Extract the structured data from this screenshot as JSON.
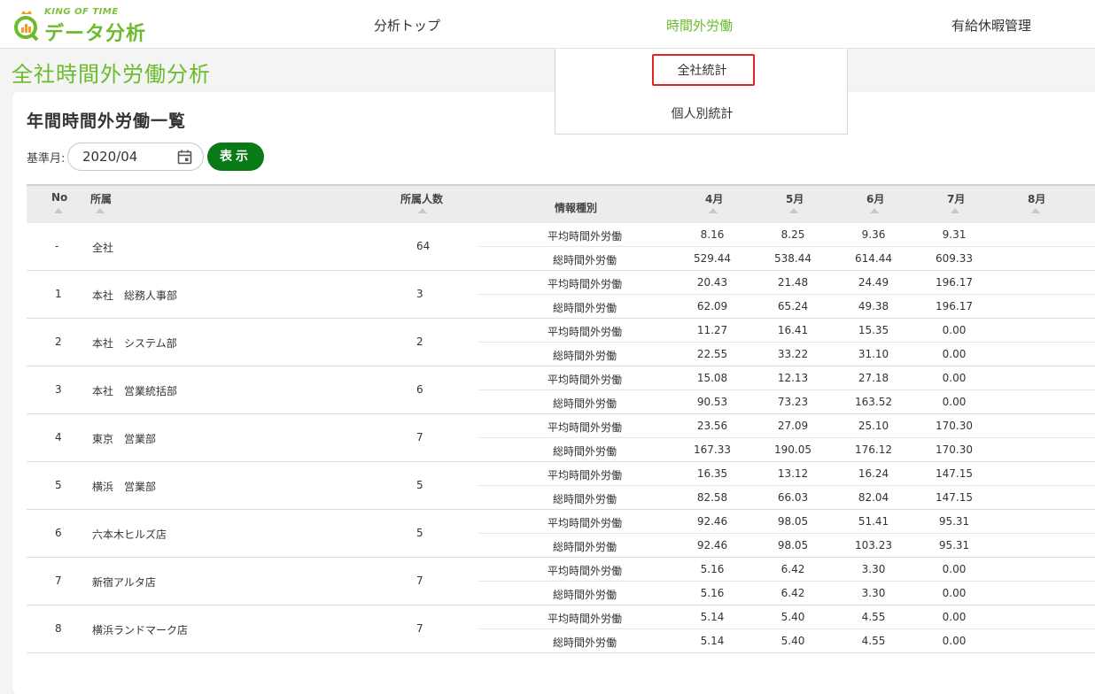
{
  "header": {
    "logo_brand": "KING OF TIME",
    "logo_title": "データ分析",
    "nav": [
      "分析トップ",
      "時間外労働",
      "有給休暇管理"
    ]
  },
  "dropdown": {
    "items": [
      "全社統計",
      "個人別統計"
    ]
  },
  "page_title": "全社時間外労働分析",
  "card": {
    "title": "年間時間外労働一覧",
    "filter_label": "基準月:",
    "month_value": "2020/04",
    "show_button": "表示"
  },
  "table": {
    "headers": {
      "no": "No",
      "dept": "所属",
      "count": "所属人数",
      "info": "情報種別",
      "months": [
        "4月",
        "5月",
        "6月",
        "7月",
        "8月"
      ]
    },
    "metric_labels": [
      "平均時間外労働",
      "総時間外労働"
    ],
    "rows": [
      {
        "no": "-",
        "dept": "全社",
        "count": "64",
        "avg": [
          "8.16",
          "8.25",
          "9.36",
          "9.31"
        ],
        "total": [
          "529.44",
          "538.44",
          "614.44",
          "609.33"
        ]
      },
      {
        "no": "1",
        "dept": "本社　総務人事部",
        "count": "3",
        "avg": [
          "20.43",
          "21.48",
          "24.49",
          "196.17"
        ],
        "total": [
          "62.09",
          "65.24",
          "49.38",
          "196.17"
        ]
      },
      {
        "no": "2",
        "dept": "本社　システム部",
        "count": "2",
        "avg": [
          "11.27",
          "16.41",
          "15.35",
          "0.00"
        ],
        "total": [
          "22.55",
          "33.22",
          "31.10",
          "0.00"
        ]
      },
      {
        "no": "3",
        "dept": "本社　営業統括部",
        "count": "6",
        "avg": [
          "15.08",
          "12.13",
          "27.18",
          "0.00"
        ],
        "total": [
          "90.53",
          "73.23",
          "163.52",
          "0.00"
        ]
      },
      {
        "no": "4",
        "dept": "東京　営業部",
        "count": "7",
        "avg": [
          "23.56",
          "27.09",
          "25.10",
          "170.30"
        ],
        "total": [
          "167.33",
          "190.05",
          "176.12",
          "170.30"
        ]
      },
      {
        "no": "5",
        "dept": "横浜　営業部",
        "count": "5",
        "avg": [
          "16.35",
          "13.12",
          "16.24",
          "147.15"
        ],
        "total": [
          "82.58",
          "66.03",
          "82.04",
          "147.15"
        ]
      },
      {
        "no": "6",
        "dept": "六本木ヒルズ店",
        "count": "5",
        "avg": [
          "92.46",
          "98.05",
          "51.41",
          "95.31"
        ],
        "total": [
          "92.46",
          "98.05",
          "103.23",
          "95.31"
        ]
      },
      {
        "no": "7",
        "dept": "新宿アルタ店",
        "count": "7",
        "avg": [
          "5.16",
          "6.42",
          "3.30",
          "0.00"
        ],
        "total": [
          "5.16",
          "6.42",
          "3.30",
          "0.00"
        ]
      },
      {
        "no": "8",
        "dept": "横浜ランドマーク店",
        "count": "7",
        "avg": [
          "5.14",
          "5.40",
          "4.55",
          "0.00"
        ],
        "total": [
          "5.14",
          "5.40",
          "4.55",
          "0.00"
        ]
      }
    ]
  },
  "colors": {
    "brand_green": "#6cbb2c",
    "button_green": "#0a7a17",
    "highlight_red": "#e02424"
  }
}
